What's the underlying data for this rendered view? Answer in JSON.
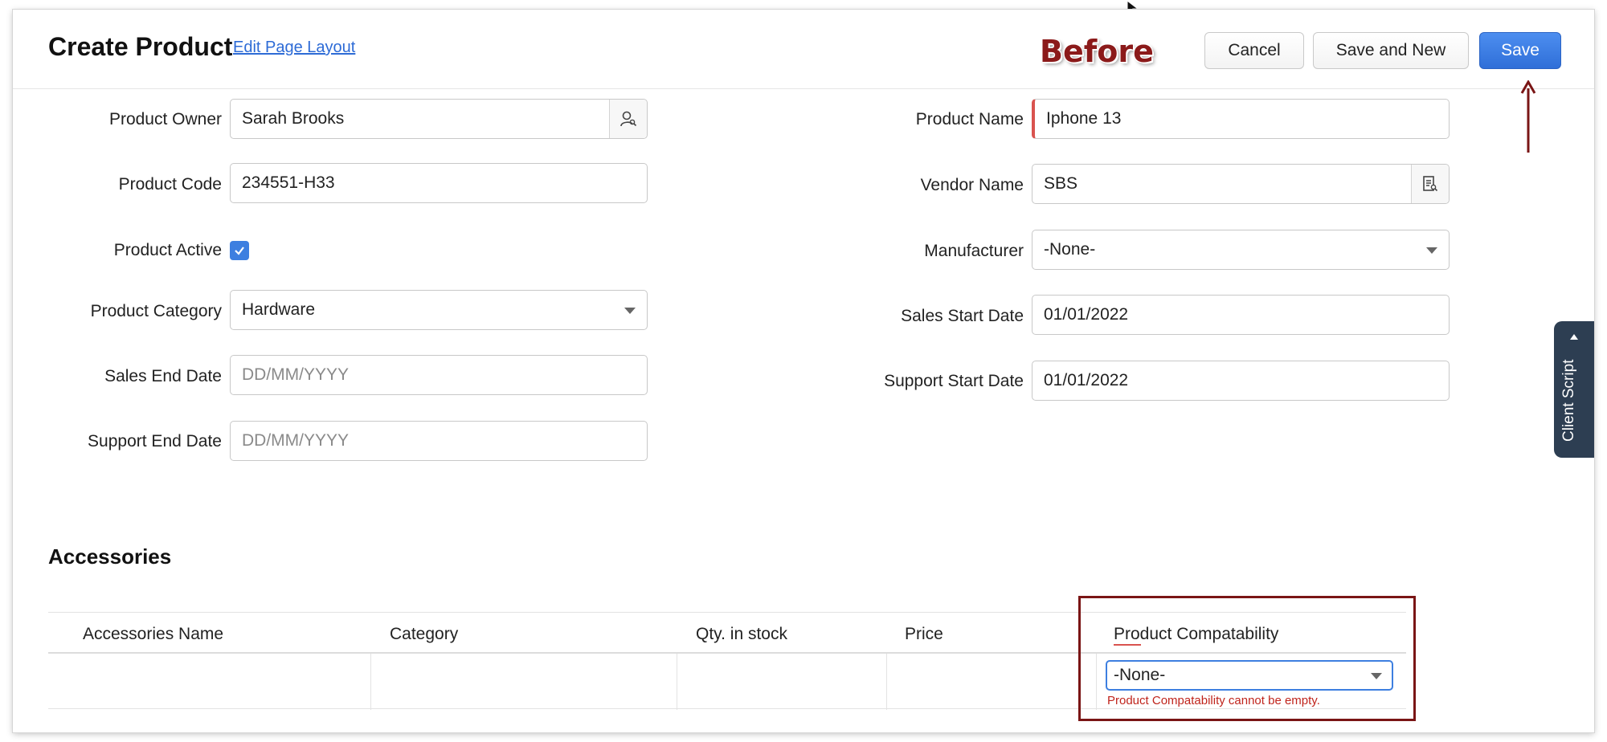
{
  "header": {
    "title": "Create Product",
    "edit_layout_link": "Edit Page Layout",
    "annotation": "Before",
    "cancel_label": "Cancel",
    "save_new_label": "Save and New",
    "save_label": "Save"
  },
  "left_fields": [
    {
      "label": "Product Owner",
      "value": "Sarah Brooks",
      "kind": "lookup-user"
    },
    {
      "label": "Product Code",
      "value": "234551-H33"
    },
    {
      "label": "Product Active",
      "value": "checked",
      "kind": "checkbox"
    },
    {
      "label": "Product Category",
      "value": "Hardware",
      "kind": "select"
    },
    {
      "label": "Sales End Date",
      "placeholder": "DD/MM/YYYY"
    },
    {
      "label": "Support End Date",
      "placeholder": "DD/MM/YYYY"
    }
  ],
  "right_fields": [
    {
      "label": "Product Name",
      "value": "Iphone 13",
      "required": true
    },
    {
      "label": "Vendor Name",
      "value": "SBS",
      "kind": "lookup-vendor"
    },
    {
      "label": "Manufacturer",
      "value": "-None-",
      "kind": "select"
    },
    {
      "label": "Sales Start Date",
      "value": "01/01/2022"
    },
    {
      "label": "Support Start Date",
      "value": "01/01/2022"
    }
  ],
  "accessories": {
    "title": "Accessories",
    "columns": [
      "Accessories Name",
      "Category",
      "Qty. in stock",
      "Price",
      "Product Compatability"
    ],
    "row": {
      "compatibility_value": "-None-",
      "error": "Product Compatability cannot be empty."
    }
  },
  "client_script_tab": "Client Script",
  "colors": {
    "primary": "#2f6fd8",
    "annotation_red": "#8b1a1a",
    "error": "#c0241c",
    "sidebar_tab": "#2d3e52"
  }
}
